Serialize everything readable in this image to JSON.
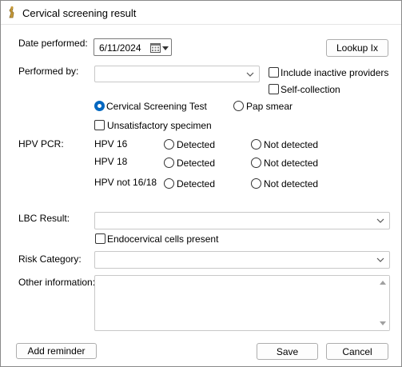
{
  "window": {
    "title": "Cervical screening result"
  },
  "date": {
    "label": "Date performed:",
    "value": "6/11/2024"
  },
  "lookup_button": "Lookup Ix",
  "performed_by": {
    "label": "Performed by:",
    "value": ""
  },
  "include_inactive": {
    "label": "Include inactive providers",
    "checked": false
  },
  "self_collection": {
    "label": "Self-collection",
    "checked": false
  },
  "test_type": {
    "options": [
      "Cervical Screening Test",
      "Pap smear"
    ],
    "selected": "Cervical Screening Test"
  },
  "unsatisfactory": {
    "label": "Unsatisfactory specimen",
    "checked": false
  },
  "hpv": {
    "label": "HPV PCR:",
    "detected_label": "Detected",
    "not_detected_label": "Not detected",
    "rows": [
      "HPV 16",
      "HPV 18",
      "HPV not 16/18"
    ]
  },
  "lbc": {
    "label": "LBC Result:",
    "value": ""
  },
  "endocervical": {
    "label": "Endocervical cells present",
    "checked": false
  },
  "risk": {
    "label": "Risk Category:",
    "value": ""
  },
  "other": {
    "label": "Other information:",
    "value": ""
  },
  "footer": {
    "add_reminder": "Add reminder",
    "save": "Save",
    "cancel": "Cancel"
  }
}
